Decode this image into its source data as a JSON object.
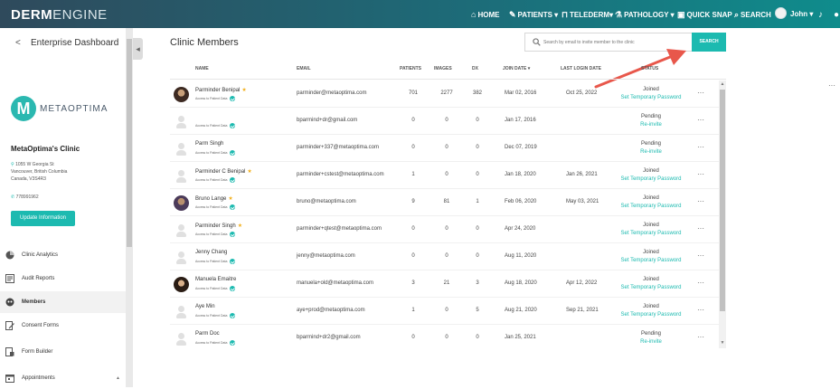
{
  "topbar": {
    "brand_a": "DERM",
    "brand_b": "ENGINE",
    "nav": [
      {
        "icon": "home-icon",
        "label": "HOME"
      },
      {
        "icon": "patients-icon",
        "label": "PATIENTS ▾"
      },
      {
        "icon": "telederm-icon",
        "label": "TELEDERM▾"
      },
      {
        "icon": "pathology-icon",
        "label": "PATHOLOGY ▾"
      },
      {
        "icon": "quicksnap-icon",
        "label": "QUICK SNAP"
      },
      {
        "icon": "search-icon",
        "label": "SEARCH"
      }
    ],
    "user_label": "John ▾"
  },
  "sidebar": {
    "back_glyph": "<",
    "title": "Enterprise Dashboard",
    "logo_mark": "M",
    "logo_text": "METAOPTIMA",
    "clinic_name": "MetaOptima's Clinic",
    "address_lines": [
      "1055 W Georgia St",
      "Vancouver, British Columbia",
      "Canada, V3S4R3"
    ],
    "phone": "778991962",
    "update_button": "Update Information",
    "menu": [
      {
        "icon": "chart-icon",
        "label": "Clinic Analytics",
        "active": false
      },
      {
        "icon": "report-icon",
        "label": "Audit Reports",
        "active": false
      },
      {
        "icon": "members-icon",
        "label": "Members",
        "active": true
      },
      {
        "icon": "form-icon",
        "label": "Consent Forms",
        "active": false
      },
      {
        "icon": "builder-icon",
        "label": "Form Builder",
        "active": false
      },
      {
        "icon": "calendar-icon",
        "label": "Appointments",
        "active": false
      }
    ]
  },
  "main": {
    "title": "Clinic Members",
    "search": {
      "placeholder": "Search by email to invite member to the clinic",
      "button": "SEARCH"
    },
    "columns": [
      "NAME",
      "EMAIL",
      "PATIENTS",
      "IMAGES",
      "DX",
      "JOIN DATE ▾",
      "LAST LOGIN DATE",
      "STATUS"
    ],
    "access_label": "Access to Patient Data",
    "rows": [
      {
        "name": "Parminder Benipal",
        "star": true,
        "avatar": "photo",
        "email": "parminder@metaoptima.com",
        "patients": "701",
        "images": "2277",
        "dx": "382",
        "join": "Mar 02, 2016",
        "last": "Oct 25, 2022",
        "status": "Joined",
        "action": "Set Temporary Password"
      },
      {
        "name": "",
        "star": false,
        "avatar": "blank",
        "email": "bparmind+dr@gmail.com",
        "patients": "0",
        "images": "0",
        "dx": "0",
        "join": "Jan 17, 2016",
        "last": "",
        "status": "Pending",
        "action": "Re-invite"
      },
      {
        "name": "Parm Singh",
        "star": false,
        "avatar": "blank",
        "email": "parminder+337@metaoptima.com",
        "patients": "0",
        "images": "0",
        "dx": "0",
        "join": "Dec 07, 2019",
        "last": "",
        "status": "Pending",
        "action": "Re-invite"
      },
      {
        "name": "Parminder C Benipal",
        "star": true,
        "avatar": "blank",
        "email": "parminder+cstest@metaoptima.com",
        "patients": "1",
        "images": "0",
        "dx": "0",
        "join": "Jan 18, 2020",
        "last": "Jan 26, 2021",
        "status": "Joined",
        "action": "Set Temporary Password"
      },
      {
        "name": "Bruno Lange",
        "star": true,
        "avatar": "photo2",
        "email": "bruno@metaoptima.com",
        "patients": "9",
        "images": "81",
        "dx": "1",
        "join": "Feb 06, 2020",
        "last": "May 03, 2021",
        "status": "Joined",
        "action": "Set Temporary Password"
      },
      {
        "name": "Parminder Singh",
        "star": true,
        "avatar": "blank",
        "email": "parminder+qtest@metaoptima.com",
        "patients": "0",
        "images": "0",
        "dx": "0",
        "join": "Apr 24, 2020",
        "last": "",
        "status": "Joined",
        "action": "Set Temporary Password"
      },
      {
        "name": "Jenny Chang",
        "star": false,
        "avatar": "blank",
        "email": "jenny@metaoptima.com",
        "patients": "0",
        "images": "0",
        "dx": "0",
        "join": "Aug 11, 2020",
        "last": "",
        "status": "Joined",
        "action": "Set Temporary Password"
      },
      {
        "name": "Manuela Emaitre",
        "star": false,
        "avatar": "photo3",
        "email": "manuela+old@metaoptima.com",
        "patients": "3",
        "images": "21",
        "dx": "3",
        "join": "Aug 18, 2020",
        "last": "Apr 12, 2022",
        "status": "Joined",
        "action": "Set Temporary Password"
      },
      {
        "name": "Aye Min",
        "star": false,
        "avatar": "blank",
        "email": "aye+prod@metaoptima.com",
        "patients": "1",
        "images": "0",
        "dx": "5",
        "join": "Aug 21, 2020",
        "last": "Sep 21, 2021",
        "status": "Joined",
        "action": "Set Temporary Password"
      },
      {
        "name": "Parm Doc",
        "star": false,
        "avatar": "blank",
        "email": "bparmind+dr2@gmail.com",
        "patients": "0",
        "images": "0",
        "dx": "0",
        "join": "Jan 25, 2021",
        "last": "",
        "status": "Pending",
        "action": "Re-invite"
      }
    ]
  },
  "colors": {
    "accent": "#1cbab0",
    "topbar": "#1d6b78",
    "annotation": "#e8574b"
  }
}
